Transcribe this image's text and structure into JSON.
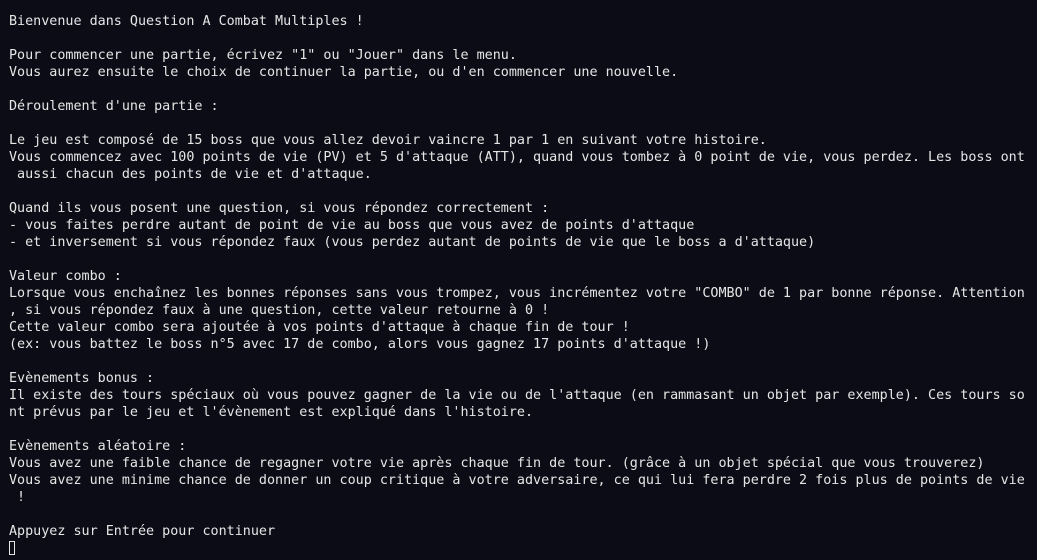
{
  "terminal": {
    "lines": [
      "Bienvenue dans Question A Combat Multiples !",
      "",
      "Pour commencer une partie, écrivez \"1\" ou \"Jouer\" dans le menu.",
      "Vous aurez ensuite le choix de continuer la partie, ou d'en commencer une nouvelle.",
      "",
      "Déroulement d'une partie :",
      "",
      "Le jeu est composé de 15 boss que vous allez devoir vaincre 1 par 1 en suivant votre histoire.",
      "Vous commencez avec 100 points de vie (PV) et 5 d'attaque (ATT), quand vous tombez à 0 point de vie, vous perdez. Les boss ont",
      " aussi chacun des points de vie et d'attaque.",
      "",
      "Quand ils vous posent une question, si vous répondez correctement :",
      "- vous faites perdre autant de point de vie au boss que vous avez de points d'attaque",
      "- et inversement si vous répondez faux (vous perdez autant de points de vie que le boss a d'attaque)",
      "",
      "Valeur combo :",
      "Lorsque vous enchaînez les bonnes réponses sans vous trompez, vous incrémentez votre \"COMBO\" de 1 par bonne réponse. Attention",
      ", si vous répondez faux à une question, cette valeur retourne à 0 !",
      "Cette valeur combo sera ajoutée à vos points d'attaque à chaque fin de tour !",
      "(ex: vous battez le boss n°5 avec 17 de combo, alors vous gagnez 17 points d'attaque !)",
      "",
      "Evènements bonus :",
      "Il existe des tours spéciaux où vous pouvez gagner de la vie ou de l'attaque (en rammasant un objet par exemple). Ces tours so",
      "nt prévus par le jeu et l'évènement est expliqué dans l'histoire.",
      "",
      "Evènements aléatoire :",
      "Vous avez une faible chance de regagner votre vie après chaque fin de tour. (grâce à un objet spécial que vous trouverez)",
      "Vous avez une minime chance de donner un coup critique à votre adversaire, ce qui lui fera perdre 2 fois plus de points de vie",
      " !",
      "",
      "Appuyez sur Entrée pour continuer"
    ]
  },
  "colors": {
    "background": "#0c0c16",
    "text": "#e6e6e6"
  }
}
